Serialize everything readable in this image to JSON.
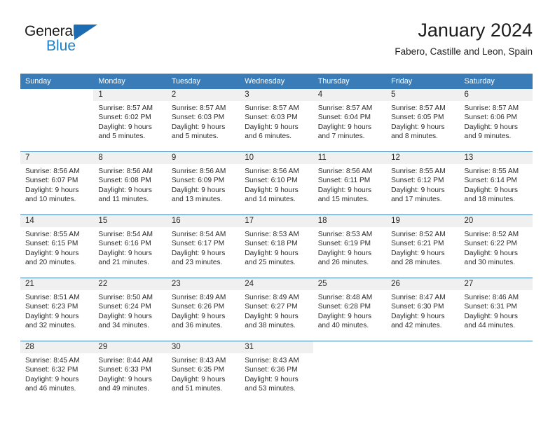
{
  "brand": {
    "name_part1": "General",
    "name_part2": "Blue",
    "triangle_color": "#1b6cb0",
    "blue_text_color": "#1b80c8"
  },
  "header": {
    "title": "January 2024",
    "subtitle": "Fabero, Castille and Leon, Spain"
  },
  "theme": {
    "header_blue": "#3a7cb8",
    "daynum_band": "#f0f0f0",
    "text": "#2b2b2b"
  },
  "weekdays": [
    "Sunday",
    "Monday",
    "Tuesday",
    "Wednesday",
    "Thursday",
    "Friday",
    "Saturday"
  ],
  "weeks": [
    [
      {
        "day": "",
        "sunrise": "",
        "sunset": "",
        "daylight1": "",
        "daylight2": "",
        "blank": true
      },
      {
        "day": "1",
        "sunrise": "Sunrise: 8:57 AM",
        "sunset": "Sunset: 6:02 PM",
        "daylight1": "Daylight: 9 hours",
        "daylight2": "and 5 minutes."
      },
      {
        "day": "2",
        "sunrise": "Sunrise: 8:57 AM",
        "sunset": "Sunset: 6:03 PM",
        "daylight1": "Daylight: 9 hours",
        "daylight2": "and 5 minutes."
      },
      {
        "day": "3",
        "sunrise": "Sunrise: 8:57 AM",
        "sunset": "Sunset: 6:03 PM",
        "daylight1": "Daylight: 9 hours",
        "daylight2": "and 6 minutes."
      },
      {
        "day": "4",
        "sunrise": "Sunrise: 8:57 AM",
        "sunset": "Sunset: 6:04 PM",
        "daylight1": "Daylight: 9 hours",
        "daylight2": "and 7 minutes."
      },
      {
        "day": "5",
        "sunrise": "Sunrise: 8:57 AM",
        "sunset": "Sunset: 6:05 PM",
        "daylight1": "Daylight: 9 hours",
        "daylight2": "and 8 minutes."
      },
      {
        "day": "6",
        "sunrise": "Sunrise: 8:57 AM",
        "sunset": "Sunset: 6:06 PM",
        "daylight1": "Daylight: 9 hours",
        "daylight2": "and 9 minutes."
      }
    ],
    [
      {
        "day": "7",
        "sunrise": "Sunrise: 8:56 AM",
        "sunset": "Sunset: 6:07 PM",
        "daylight1": "Daylight: 9 hours",
        "daylight2": "and 10 minutes."
      },
      {
        "day": "8",
        "sunrise": "Sunrise: 8:56 AM",
        "sunset": "Sunset: 6:08 PM",
        "daylight1": "Daylight: 9 hours",
        "daylight2": "and 11 minutes."
      },
      {
        "day": "9",
        "sunrise": "Sunrise: 8:56 AM",
        "sunset": "Sunset: 6:09 PM",
        "daylight1": "Daylight: 9 hours",
        "daylight2": "and 13 minutes."
      },
      {
        "day": "10",
        "sunrise": "Sunrise: 8:56 AM",
        "sunset": "Sunset: 6:10 PM",
        "daylight1": "Daylight: 9 hours",
        "daylight2": "and 14 minutes."
      },
      {
        "day": "11",
        "sunrise": "Sunrise: 8:56 AM",
        "sunset": "Sunset: 6:11 PM",
        "daylight1": "Daylight: 9 hours",
        "daylight2": "and 15 minutes."
      },
      {
        "day": "12",
        "sunrise": "Sunrise: 8:55 AM",
        "sunset": "Sunset: 6:12 PM",
        "daylight1": "Daylight: 9 hours",
        "daylight2": "and 17 minutes."
      },
      {
        "day": "13",
        "sunrise": "Sunrise: 8:55 AM",
        "sunset": "Sunset: 6:14 PM",
        "daylight1": "Daylight: 9 hours",
        "daylight2": "and 18 minutes."
      }
    ],
    [
      {
        "day": "14",
        "sunrise": "Sunrise: 8:55 AM",
        "sunset": "Sunset: 6:15 PM",
        "daylight1": "Daylight: 9 hours",
        "daylight2": "and 20 minutes."
      },
      {
        "day": "15",
        "sunrise": "Sunrise: 8:54 AM",
        "sunset": "Sunset: 6:16 PM",
        "daylight1": "Daylight: 9 hours",
        "daylight2": "and 21 minutes."
      },
      {
        "day": "16",
        "sunrise": "Sunrise: 8:54 AM",
        "sunset": "Sunset: 6:17 PM",
        "daylight1": "Daylight: 9 hours",
        "daylight2": "and 23 minutes."
      },
      {
        "day": "17",
        "sunrise": "Sunrise: 8:53 AM",
        "sunset": "Sunset: 6:18 PM",
        "daylight1": "Daylight: 9 hours",
        "daylight2": "and 25 minutes."
      },
      {
        "day": "18",
        "sunrise": "Sunrise: 8:53 AM",
        "sunset": "Sunset: 6:19 PM",
        "daylight1": "Daylight: 9 hours",
        "daylight2": "and 26 minutes."
      },
      {
        "day": "19",
        "sunrise": "Sunrise: 8:52 AM",
        "sunset": "Sunset: 6:21 PM",
        "daylight1": "Daylight: 9 hours",
        "daylight2": "and 28 minutes."
      },
      {
        "day": "20",
        "sunrise": "Sunrise: 8:52 AM",
        "sunset": "Sunset: 6:22 PM",
        "daylight1": "Daylight: 9 hours",
        "daylight2": "and 30 minutes."
      }
    ],
    [
      {
        "day": "21",
        "sunrise": "Sunrise: 8:51 AM",
        "sunset": "Sunset: 6:23 PM",
        "daylight1": "Daylight: 9 hours",
        "daylight2": "and 32 minutes."
      },
      {
        "day": "22",
        "sunrise": "Sunrise: 8:50 AM",
        "sunset": "Sunset: 6:24 PM",
        "daylight1": "Daylight: 9 hours",
        "daylight2": "and 34 minutes."
      },
      {
        "day": "23",
        "sunrise": "Sunrise: 8:49 AM",
        "sunset": "Sunset: 6:26 PM",
        "daylight1": "Daylight: 9 hours",
        "daylight2": "and 36 minutes."
      },
      {
        "day": "24",
        "sunrise": "Sunrise: 8:49 AM",
        "sunset": "Sunset: 6:27 PM",
        "daylight1": "Daylight: 9 hours",
        "daylight2": "and 38 minutes."
      },
      {
        "day": "25",
        "sunrise": "Sunrise: 8:48 AM",
        "sunset": "Sunset: 6:28 PM",
        "daylight1": "Daylight: 9 hours",
        "daylight2": "and 40 minutes."
      },
      {
        "day": "26",
        "sunrise": "Sunrise: 8:47 AM",
        "sunset": "Sunset: 6:30 PM",
        "daylight1": "Daylight: 9 hours",
        "daylight2": "and 42 minutes."
      },
      {
        "day": "27",
        "sunrise": "Sunrise: 8:46 AM",
        "sunset": "Sunset: 6:31 PM",
        "daylight1": "Daylight: 9 hours",
        "daylight2": "and 44 minutes."
      }
    ],
    [
      {
        "day": "28",
        "sunrise": "Sunrise: 8:45 AM",
        "sunset": "Sunset: 6:32 PM",
        "daylight1": "Daylight: 9 hours",
        "daylight2": "and 46 minutes."
      },
      {
        "day": "29",
        "sunrise": "Sunrise: 8:44 AM",
        "sunset": "Sunset: 6:33 PM",
        "daylight1": "Daylight: 9 hours",
        "daylight2": "and 49 minutes."
      },
      {
        "day": "30",
        "sunrise": "Sunrise: 8:43 AM",
        "sunset": "Sunset: 6:35 PM",
        "daylight1": "Daylight: 9 hours",
        "daylight2": "and 51 minutes."
      },
      {
        "day": "31",
        "sunrise": "Sunrise: 8:43 AM",
        "sunset": "Sunset: 6:36 PM",
        "daylight1": "Daylight: 9 hours",
        "daylight2": "and 53 minutes."
      },
      {
        "day": "",
        "sunrise": "",
        "sunset": "",
        "daylight1": "",
        "daylight2": "",
        "blank": true
      },
      {
        "day": "",
        "sunrise": "",
        "sunset": "",
        "daylight1": "",
        "daylight2": "",
        "blank": true
      },
      {
        "day": "",
        "sunrise": "",
        "sunset": "",
        "daylight1": "",
        "daylight2": "",
        "blank": true
      }
    ]
  ]
}
